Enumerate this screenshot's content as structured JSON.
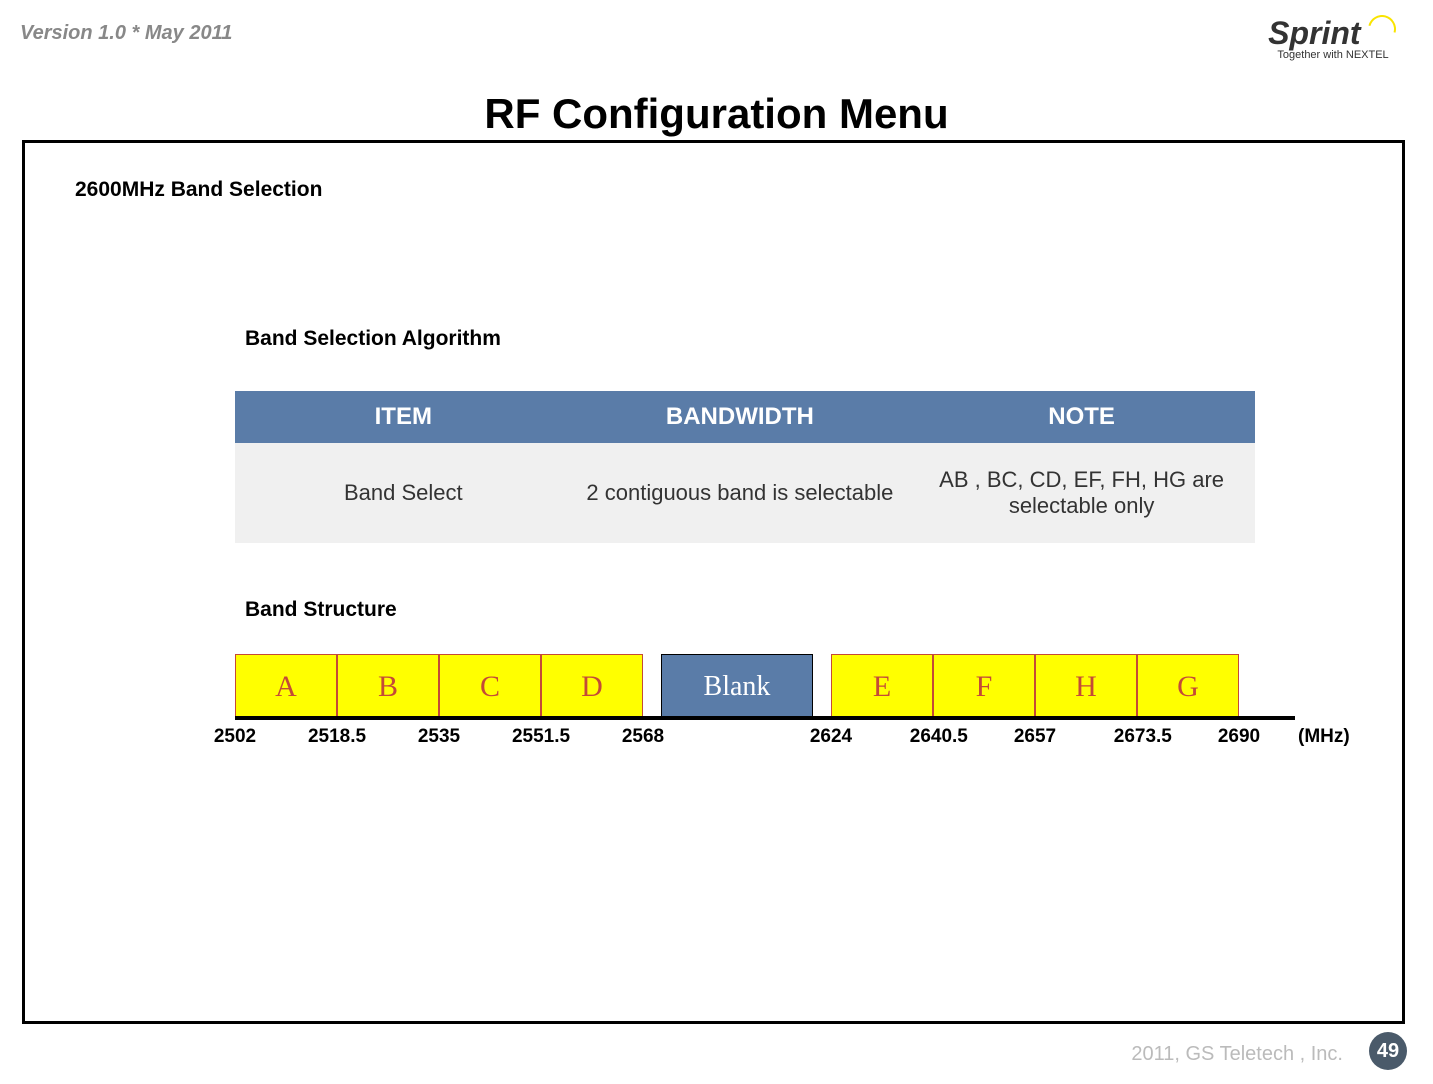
{
  "header": {
    "version": "Version 1.0 * May 2011",
    "logo_text": "Sprint",
    "logo_subtitle": "Together with NEXTEL"
  },
  "title": "RF Configuration Menu",
  "section_title": "2600MHz Band Selection",
  "subsection_algorithm": "Band Selection Algorithm",
  "subsection_structure": "Band Structure",
  "table": {
    "headers": {
      "item": "ITEM",
      "bandwidth": "BANDWIDTH",
      "note": "NOTE"
    },
    "row": {
      "item": "Band Select",
      "bandwidth": "2 contiguous band is selectable",
      "note": "AB , BC, CD, EF, FH, HG are selectable only"
    }
  },
  "bands": {
    "left": [
      "A",
      "B",
      "C",
      "D"
    ],
    "blank": "Blank",
    "right": [
      "E",
      "F",
      "H",
      "G"
    ]
  },
  "frequencies": {
    "f0": "2502",
    "f1": "2518.5",
    "f2": "2535",
    "f3": "2551.5",
    "f4": "2568",
    "f5": "2624",
    "f6": "2640.5",
    "f7": "2657",
    "f8": "2673.5",
    "f9": "2690",
    "unit": "(MHz)"
  },
  "footer": {
    "copyright": "2011, GS Teletech , Inc.",
    "page": "49"
  },
  "chart_data": {
    "type": "table",
    "title": "2600MHz Band Structure",
    "unit": "MHz",
    "bands": [
      {
        "name": "A",
        "start": 2502,
        "end": 2518.5
      },
      {
        "name": "B",
        "start": 2518.5,
        "end": 2535
      },
      {
        "name": "C",
        "start": 2535,
        "end": 2551.5
      },
      {
        "name": "D",
        "start": 2551.5,
        "end": 2568
      },
      {
        "name": "Blank",
        "start": 2568,
        "end": 2624
      },
      {
        "name": "E",
        "start": 2624,
        "end": 2640.5
      },
      {
        "name": "F",
        "start": 2640.5,
        "end": 2657
      },
      {
        "name": "H",
        "start": 2657,
        "end": 2673.5
      },
      {
        "name": "G",
        "start": 2673.5,
        "end": 2690
      }
    ]
  }
}
